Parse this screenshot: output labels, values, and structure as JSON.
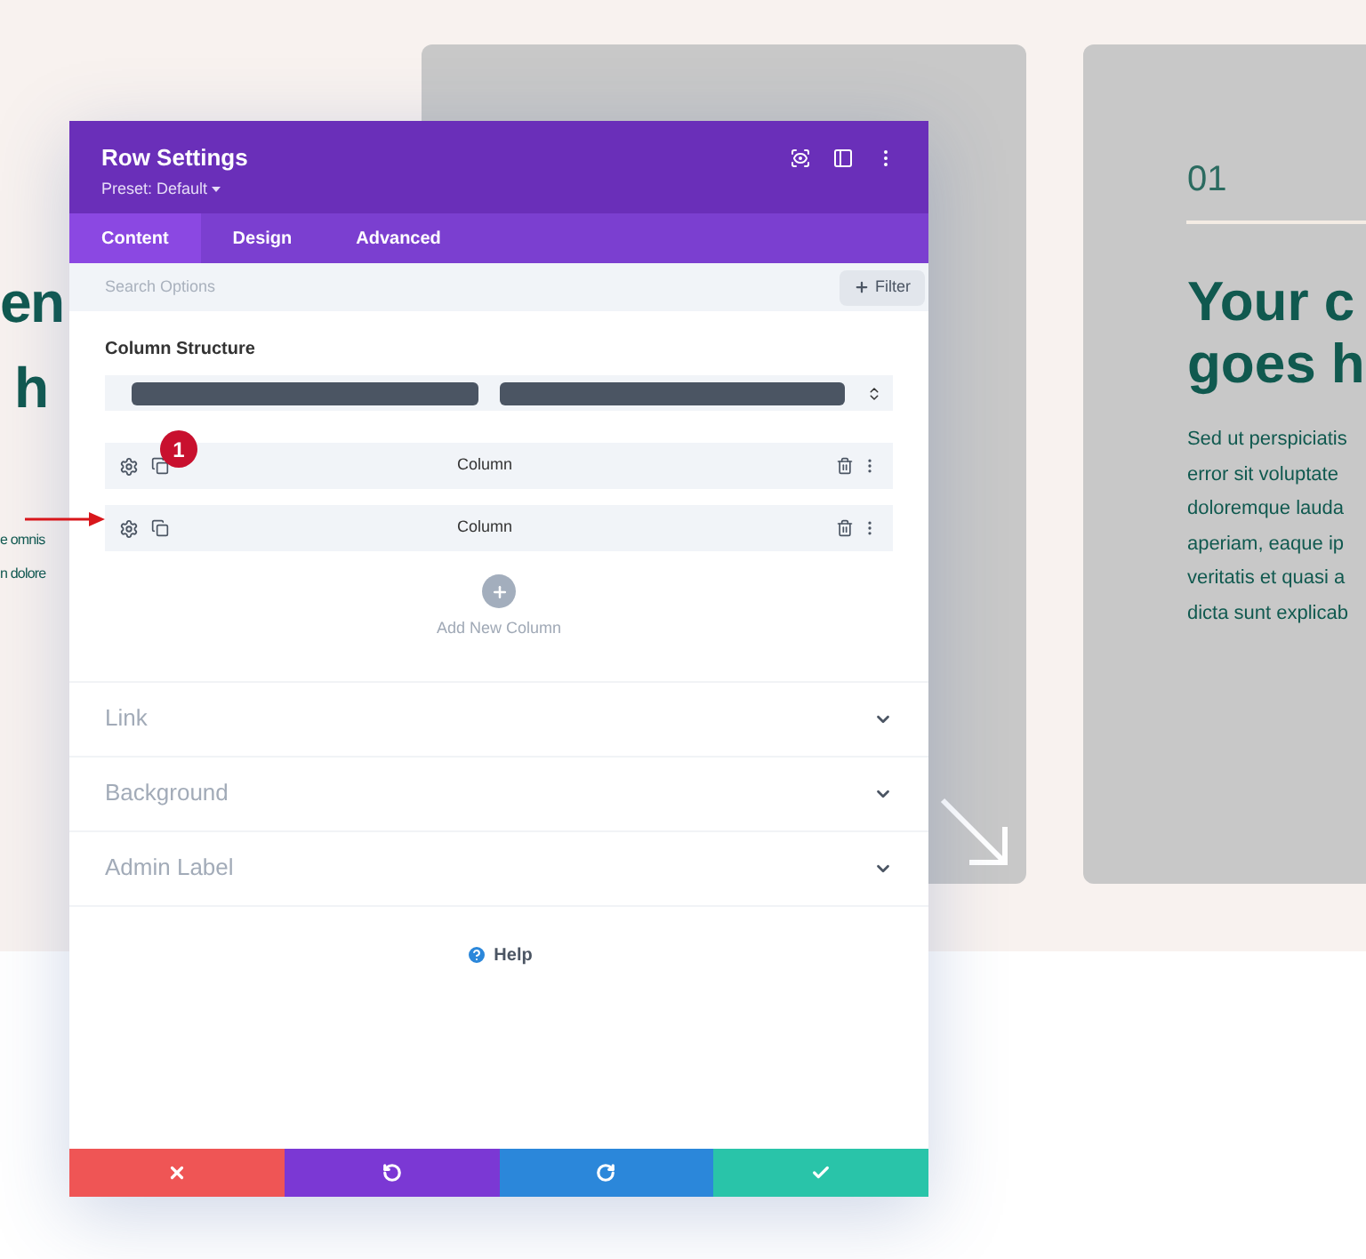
{
  "background_page": {
    "left_heading_lines": [
      "en",
      "h"
    ],
    "left_text_lines": [
      "e omnis",
      "n dolore"
    ],
    "card": {
      "number": "01",
      "heading_lines": [
        "Your c",
        "goes h"
      ],
      "body_lines": [
        "Sed ut perspiciatis",
        "error sit voluptate",
        "doloremque lauda",
        "aperiam, eaque ip",
        "veritatis et quasi a",
        "dicta sunt explicab"
      ]
    }
  },
  "dialog": {
    "title": "Row Settings",
    "preset": "Preset: Default",
    "tabs": [
      {
        "label": "Content",
        "selected": true
      },
      {
        "label": "Design",
        "selected": false
      },
      {
        "label": "Advanced",
        "selected": false
      }
    ],
    "search": {
      "placeholder": "Search Options"
    },
    "filter_button": "Filter",
    "column_structure": {
      "label": "Column Structure"
    },
    "columns": [
      {
        "label": "Column"
      },
      {
        "label": "Column"
      }
    ],
    "add_column": "Add New Column",
    "sections": [
      {
        "label": "Link",
        "expanded": false
      },
      {
        "label": "Background",
        "expanded": false
      },
      {
        "label": "Admin Label",
        "expanded": false
      }
    ],
    "help": "Help",
    "footer_buttons": [
      {
        "kind": "cancel"
      },
      {
        "kind": "undo"
      },
      {
        "kind": "redo"
      },
      {
        "kind": "save"
      }
    ]
  },
  "annotation": {
    "badge": "1"
  }
}
